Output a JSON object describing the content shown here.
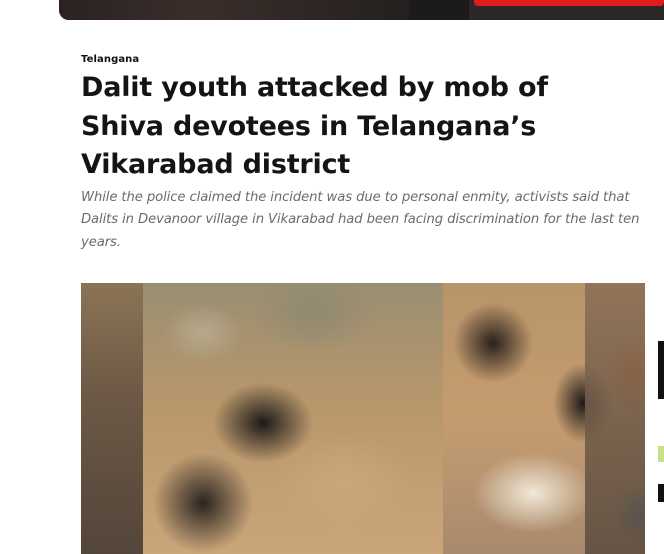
{
  "article": {
    "category": "Telangana",
    "headline": "Dalit youth attacked by mob of Shiva devotees in Telangana’s Vikarabad district",
    "subheadline": "While the police claimed the incident was due to personal enmity, activists said that Dalits in Devanoor village in Vikarabad had been facing discrimination for the last ten years."
  },
  "colors": {
    "headline": "#141414",
    "subheadline": "#6b6b6b",
    "banner_cta": "#e21b1b"
  }
}
